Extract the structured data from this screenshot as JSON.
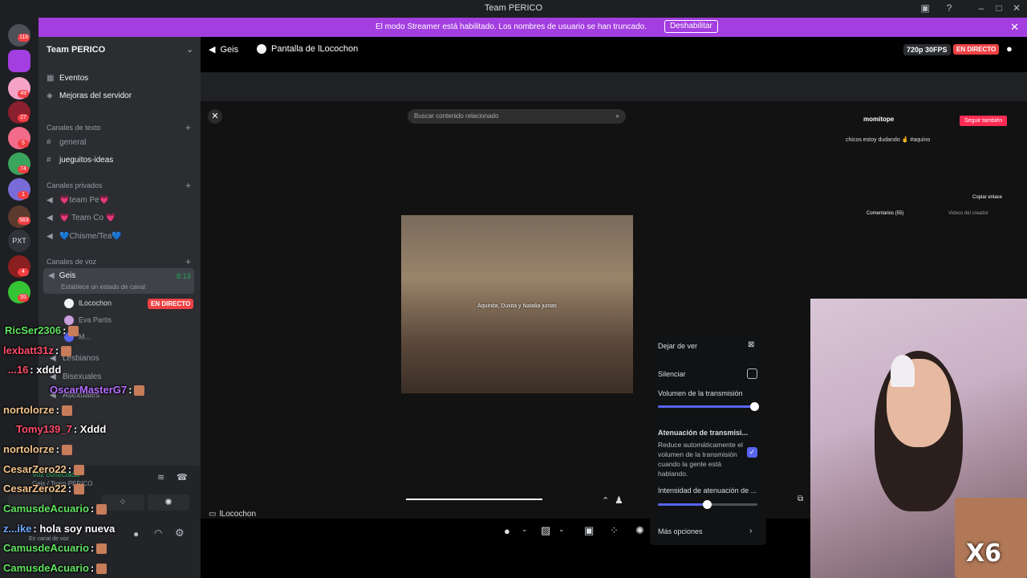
{
  "window": {
    "title": "Team PERICO"
  },
  "banner": {
    "message": "El modo Streamer está habilitado. Los nombres de usuario se han truncado.",
    "button": "Deshabilitar"
  },
  "rail": {
    "badges": [
      "118",
      "49",
      "27",
      "5",
      "74",
      "1",
      "583",
      "4",
      "55"
    ],
    "pxt": "PXT"
  },
  "sidebar": {
    "server": "Team PERICO",
    "events": "Eventos",
    "boost": "Mejoras del servidor",
    "text_cat": "Canales de texto",
    "text_channels": [
      "general",
      "jueguitos-ideas"
    ],
    "private_cat": "Canales privados",
    "private_channels": [
      "💗team Pe💗",
      "💗 Team Co 💗",
      "💙Chisme/Tea💙"
    ],
    "voice_cat": "Canales de voz",
    "voice_channel": "Geis",
    "voice_status": "Establece un estado de canal",
    "voice_time": "8:13",
    "members": [
      "lLocochon",
      "Eva Partis",
      "M..."
    ],
    "live": "EN DIRECTO",
    "other_voice": [
      "Lesbianos",
      "Bisexuales",
      "Asexuales"
    ],
    "connected": "Voz conectada",
    "connected_sub": "Geis / Team PERICO",
    "user_status": "En canal de voz"
  },
  "header": {
    "channel": "Geis",
    "stream": "Pantalla de lLocochon",
    "quality": "720p 30FPS",
    "live": "EN DIRECTO"
  },
  "stream": {
    "search_placeholder": "Buscar contenido relacionado",
    "subtitle": "Aquinita, Duxita y Natalia juntas",
    "tab_label": "lLocochon",
    "tiktok_user": "momitope",
    "tiktok_follow": "Seguir también",
    "tiktok_caption": "chicos estoy dudando 🤞 #aquino",
    "tiktok_comments": "Comentarios (55)",
    "tiktok_creator": "Videos del creador",
    "copy_link": "Copiar enlace"
  },
  "menu": {
    "stop": "Dejar de ver",
    "mute": "Silenciar",
    "volume": "Volumen de la transmisión",
    "volume_level": 0.97,
    "atten_title": "Atenuación de transmisi...",
    "atten_desc": "Reduce automáticamente el volumen de la transmisión cuando la gente está hablando.",
    "intensity": "Intensidad de atenuación de ...",
    "intensity_level": 0.5,
    "more": "Más opciones"
  },
  "chat": [
    {
      "user": "RicSer2306",
      "msg": ":",
      "color": "#5ee35e"
    },
    {
      "user": "lexbatt31z",
      "msg": ":",
      "color": "#ff4d6a"
    },
    {
      "user": "...16",
      "msg": ": xddd",
      "color": "#ff4d6a"
    },
    {
      "user": "OscarMasterG7",
      "msg": ":",
      "color": "#b36bff"
    },
    {
      "user": "nortolorze",
      "msg": ":",
      "color": "#f2c28a"
    },
    {
      "user": "Tomy139_7",
      "msg": ": Xddd",
      "color": "#ff4d6a"
    },
    {
      "user": "nortolorze",
      "msg": ":",
      "color": "#f2c28a"
    },
    {
      "user": "CesarZero22",
      "msg": ":",
      "color": "#f2c28a"
    },
    {
      "user": "CesarZero22",
      "msg": ":",
      "color": "#f2c28a"
    },
    {
      "user": "CamusdeAcuario",
      "msg": ":",
      "color": "#5ee35e"
    },
    {
      "user": "z...ike",
      "msg": ": hola soy nueva",
      "color": "#6ea8ff"
    },
    {
      "user": "CamusdeAcuario",
      "msg": ":",
      "color": "#5ee35e"
    },
    {
      "user": "CamusdeAcuario",
      "msg": ":",
      "color": "#5ee35e"
    }
  ],
  "cam": {
    "overlay": "X6"
  },
  "colors": {
    "accent": "#5865f2",
    "live": "#ed4245",
    "banner": "#a33ee0"
  }
}
